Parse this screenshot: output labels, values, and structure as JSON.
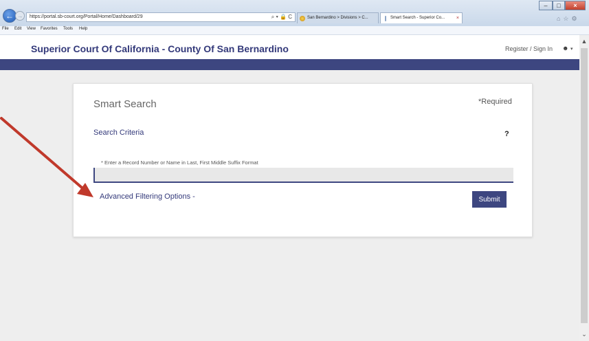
{
  "browser": {
    "address": "https://portal.sb-court.org/Portal/Home/Dashboard/29",
    "address_icons": "⌕ ▾ 🔒 C",
    "tabs": [
      {
        "label": "San Bernardino > Divisions > C...",
        "close": ""
      },
      {
        "label": "Smart Search - Superior Co...",
        "close": "×"
      }
    ],
    "window_controls": {
      "minimize": "–",
      "maximize": "□",
      "close": "×"
    },
    "toolbar_icons": "⌂☆⚙"
  },
  "menu": [
    "File",
    "Edit",
    "View",
    "Favorites",
    "Tools",
    "Help"
  ],
  "header": {
    "title": "Superior Court Of California - County Of San Bernardino",
    "signin": "Register / Sign In",
    "user_icon": "user-icon",
    "caret": "▾"
  },
  "search": {
    "title": "Smart Search",
    "required": "*Required",
    "criteria": "Search Criteria",
    "help": "?",
    "field_label": "* Enter a Record Number or Name in Last, First Middle Suffix Format",
    "input_value": "",
    "advanced": "Advanced Filtering Options -",
    "submit": "Submit"
  },
  "colors": {
    "brand": "#3d4680",
    "title_text": "#33397a",
    "annotation_arrow": "#c0392b"
  },
  "scrollbar": {
    "up": "▲",
    "down": "⌄"
  }
}
